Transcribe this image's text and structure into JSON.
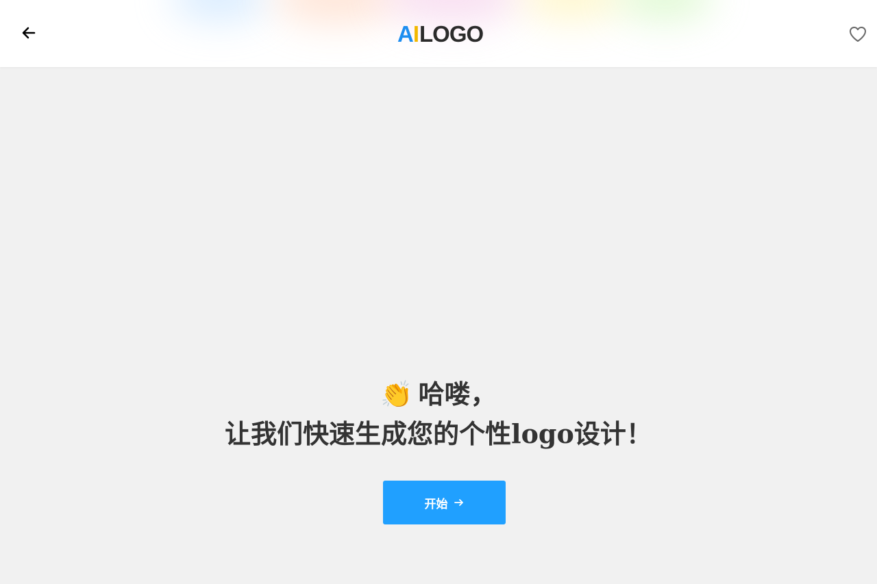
{
  "header": {
    "logo": {
      "part_a": "A",
      "part_i": "I",
      "part_rest": "LOGO"
    },
    "back_icon": "arrow-left-icon",
    "favorite_icon": "heart-outline-icon"
  },
  "hero": {
    "emoji": "👏",
    "greeting": "哈喽，",
    "subtitle": "让我们快速生成您的个性logo设计！"
  },
  "start_button": {
    "label": "开始"
  },
  "colors": {
    "background": "#f1f1f1",
    "header_background": "#ffffff",
    "button_blue": "#20a0ff",
    "text_dark": "#333333",
    "logo_blue": "#1d8ef0",
    "logo_yellow": "#f2b800"
  }
}
